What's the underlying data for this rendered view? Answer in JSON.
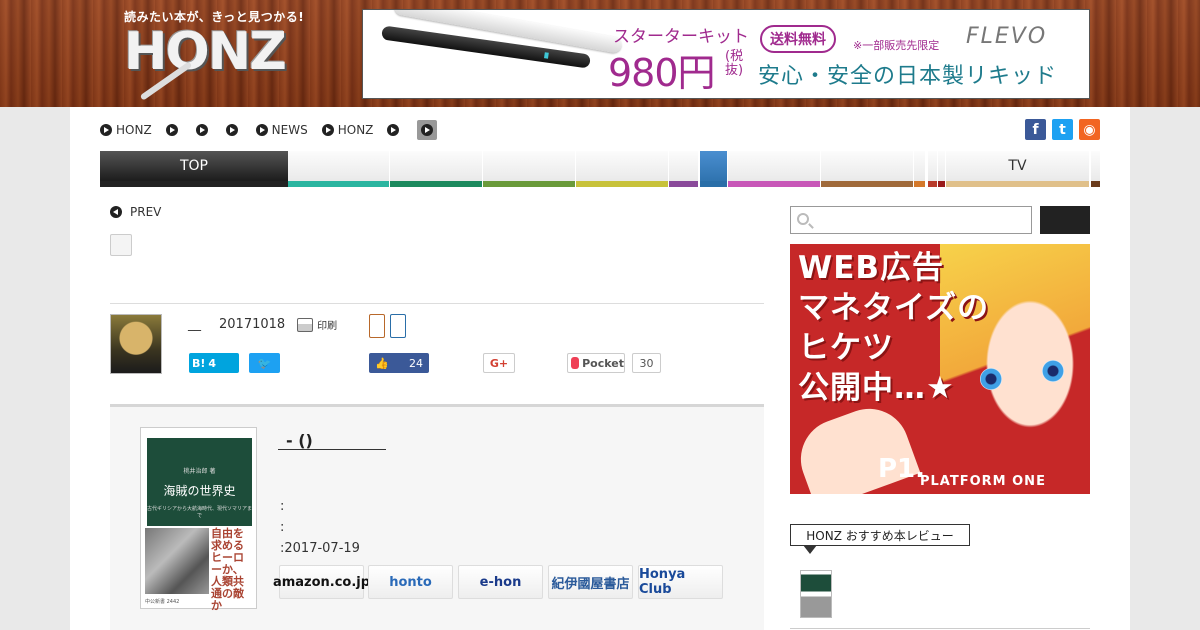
{
  "header": {
    "logo_tagline": "読みたい本が、きっと見つかる!",
    "logo_word": "HONZ",
    "ad": {
      "headline": "スターターキット",
      "price": "980円",
      "price_note": "(税抜)",
      "badge": "送料無料",
      "note": "※一部販売先限定",
      "brand": "FLEVO",
      "tagline": "安心・安全の日本製リキッド"
    }
  },
  "topnav": {
    "items": [
      "HONZ",
      "",
      "",
      "",
      "NEWS",
      "HONZ",
      "",
      ""
    ]
  },
  "social_top": [
    {
      "name": "facebook",
      "glyph": "f",
      "color": "#3b5998"
    },
    {
      "name": "twitter",
      "glyph": "t",
      "color": "#1da1f2"
    },
    {
      "name": "rss",
      "glyph": "◉",
      "color": "#f26522"
    }
  ],
  "categories": [
    {
      "label": "TOP",
      "color": "#222222",
      "active": true
    },
    {
      "label": "",
      "color": "#2bb5a0"
    },
    {
      "label": "",
      "color": "#1d8a5e"
    },
    {
      "label": "",
      "color": "#6a9a3a"
    },
    {
      "label": "",
      "color": "#c8c23a"
    },
    {
      "label": "",
      "color": "#8a4a9a"
    },
    {
      "label": "",
      "color": "#2a6ea8"
    },
    {
      "label": "",
      "color": "#c857b8"
    },
    {
      "label": "",
      "color": "#a06a3a"
    },
    {
      "label": "",
      "color": "#d4782a"
    },
    {
      "label": "",
      "color": "#b83a2a"
    },
    {
      "label": "",
      "color": "#9a1a1a"
    },
    {
      "label": "TV",
      "color": "#e0c08a"
    },
    {
      "label": "",
      "color": "#6a3a1a"
    }
  ],
  "article": {
    "prev_label": "PREV",
    "author_name": "__",
    "date": "20171018",
    "print_label": "印刷",
    "share": {
      "hatena_label": "B!",
      "hatena_count": "4",
      "facebook_count": "24",
      "gplus_label": "G+",
      "pocket_label": "Pocket",
      "pocket_count": "30"
    }
  },
  "book": {
    "title": "-  ()",
    "cover": {
      "author": "桃井治郎 著",
      "title": "海賊の世界史",
      "subtitle": "古代ギリシアから大航海時代、現代ソマリアまで",
      "vertical_text": "自由を求めるヒーローか、人類共通の敵か",
      "publisher": "中公新書 2442"
    },
    "meta": [
      ":",
      ":",
      ":2017-07-19"
    ],
    "stores": [
      {
        "name": "amazon",
        "label": "amazon.co.jp",
        "color": "#111111"
      },
      {
        "name": "honto",
        "label": "honto",
        "color": "#2a6ab8"
      },
      {
        "name": "ehon",
        "label": "e-hon",
        "color": "#1a3a8a"
      },
      {
        "name": "kinokuniya",
        "label": "紀伊國屋書店",
        "color": "#2a5a9a"
      },
      {
        "name": "honyaclub",
        "label": "Honya Club",
        "color": "#1a4a9a"
      }
    ]
  },
  "sidebar": {
    "search_placeholder": "",
    "ad_text": [
      "WEB広告",
      "マネタイズの",
      "ヒケツ",
      "公開中…★"
    ],
    "ad_brand": "P1.",
    "ad_brand_sub": "PLATFORM ONE",
    "recommend_title": "HONZ おすすめ本レビュー"
  }
}
